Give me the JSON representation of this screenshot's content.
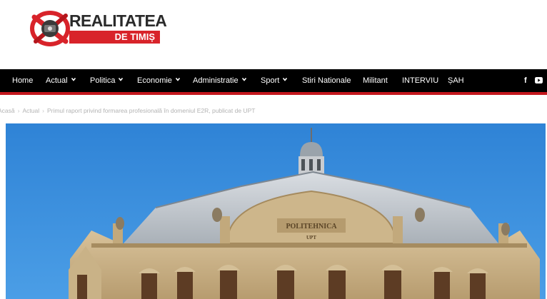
{
  "site": {
    "logo_title": "REALITATEA",
    "logo_subtitle": "DE TIMIȘ",
    "colors": {
      "brand_red": "#d8232a",
      "nav_bg": "#000000",
      "nav_border": "#c4171d"
    }
  },
  "nav": {
    "items": [
      {
        "label": "Home",
        "has_dropdown": false
      },
      {
        "label": "Actual",
        "has_dropdown": true
      },
      {
        "label": "Politica",
        "has_dropdown": true
      },
      {
        "label": "Economie",
        "has_dropdown": true
      },
      {
        "label": "Administratie",
        "has_dropdown": true
      },
      {
        "label": "Sport",
        "has_dropdown": true
      },
      {
        "label": "Stiri Nationale",
        "has_dropdown": false
      },
      {
        "label": "Militant",
        "has_dropdown": false
      },
      {
        "label": "INTERVIU",
        "has_dropdown": false
      },
      {
        "label": "ȘAH",
        "has_dropdown": false
      }
    ],
    "social": {
      "facebook": "f",
      "youtube_icon": "youtube-icon"
    }
  },
  "breadcrumb": {
    "items": [
      "Acasă",
      "Actual",
      "Primul raport privind formarea profesională în domeniul E2R, publicat de UPT"
    ],
    "separator": "›"
  },
  "hero": {
    "building_sign": "POLITEHNICA",
    "building_sign_sub": "UPT"
  }
}
